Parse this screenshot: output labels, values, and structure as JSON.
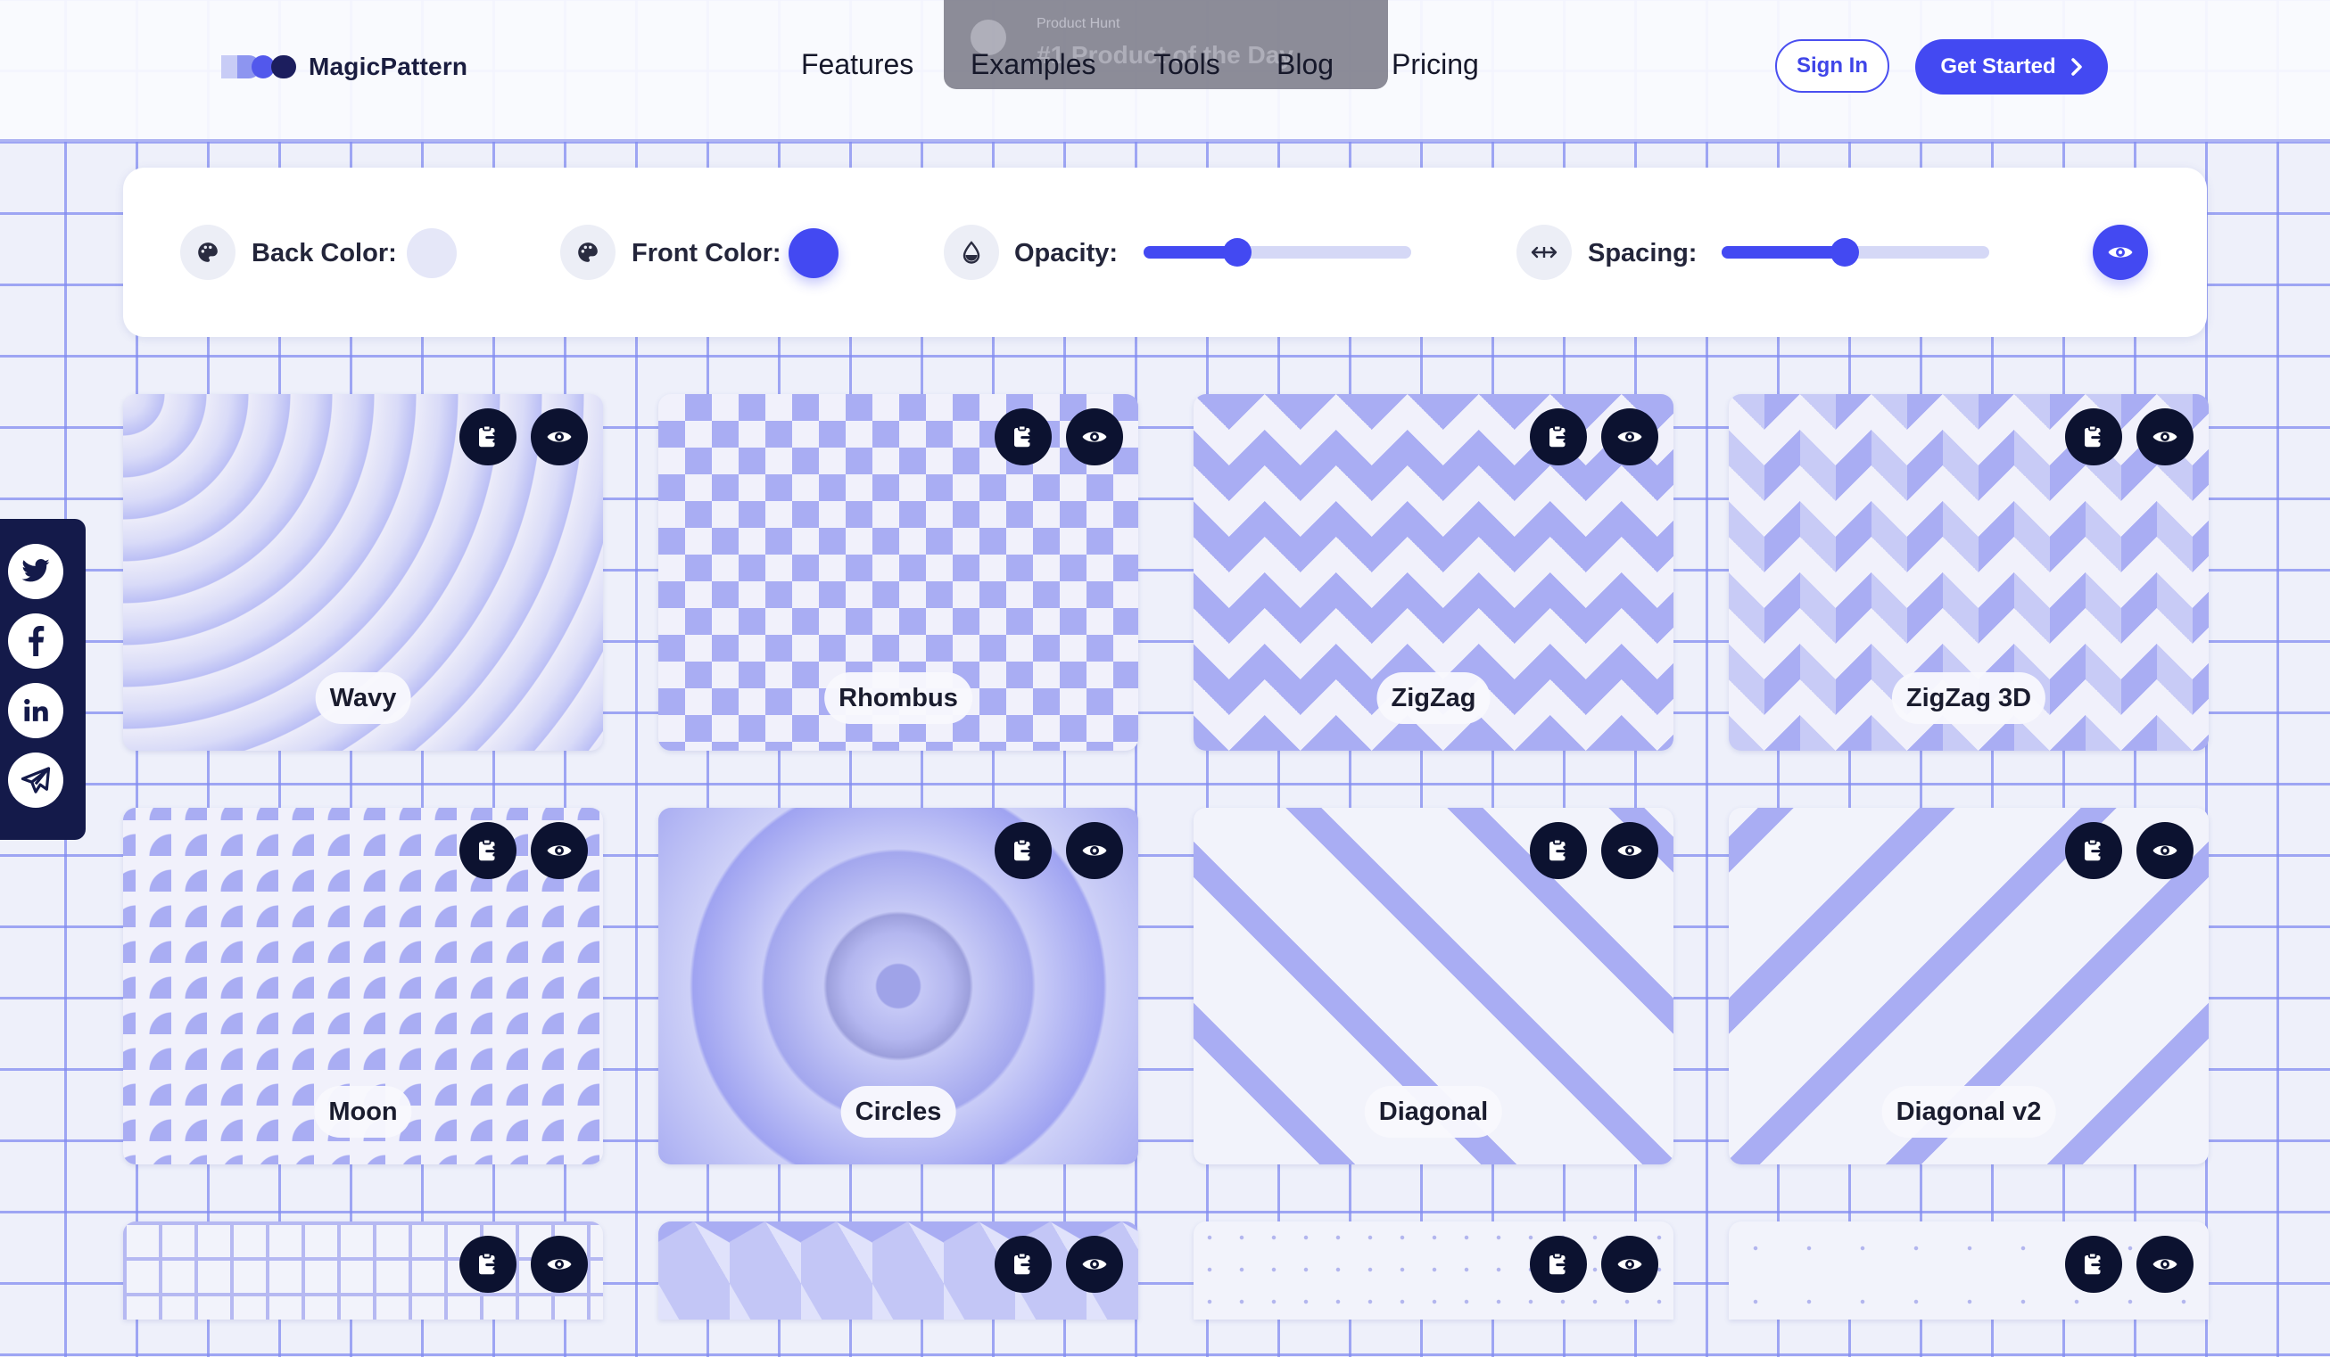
{
  "brand": {
    "name": "MagicPattern"
  },
  "toast": {
    "small": "Product Hunt",
    "big": "#1 Product of the Day"
  },
  "nav": {
    "items": [
      "Features",
      "Examples",
      "Tools",
      "Blog",
      "Pricing"
    ],
    "sign_in": "Sign In",
    "get_started": "Get Started"
  },
  "controls": {
    "back_color_label": "Back Color:",
    "front_color_label": "Front Color:",
    "opacity_label": "Opacity:",
    "spacing_label": "Spacing:",
    "back_color": "#e5e7f8",
    "front_color": "#4349f2",
    "opacity_value": 0.35,
    "spacing_value": 0.46
  },
  "social": {
    "icons": [
      "twitter-icon",
      "facebook-icon",
      "linkedin-icon",
      "telegram-icon"
    ]
  },
  "patterns": [
    {
      "name": "Wavy"
    },
    {
      "name": "Rhombus"
    },
    {
      "name": "ZigZag"
    },
    {
      "name": "ZigZag 3D"
    },
    {
      "name": "Moon"
    },
    {
      "name": "Circles"
    },
    {
      "name": "Diagonal"
    },
    {
      "name": "Diagonal v2"
    }
  ],
  "colors": {
    "accent": "#4349f2",
    "dark": "#0c1230",
    "pattern": "#a9adf3"
  }
}
